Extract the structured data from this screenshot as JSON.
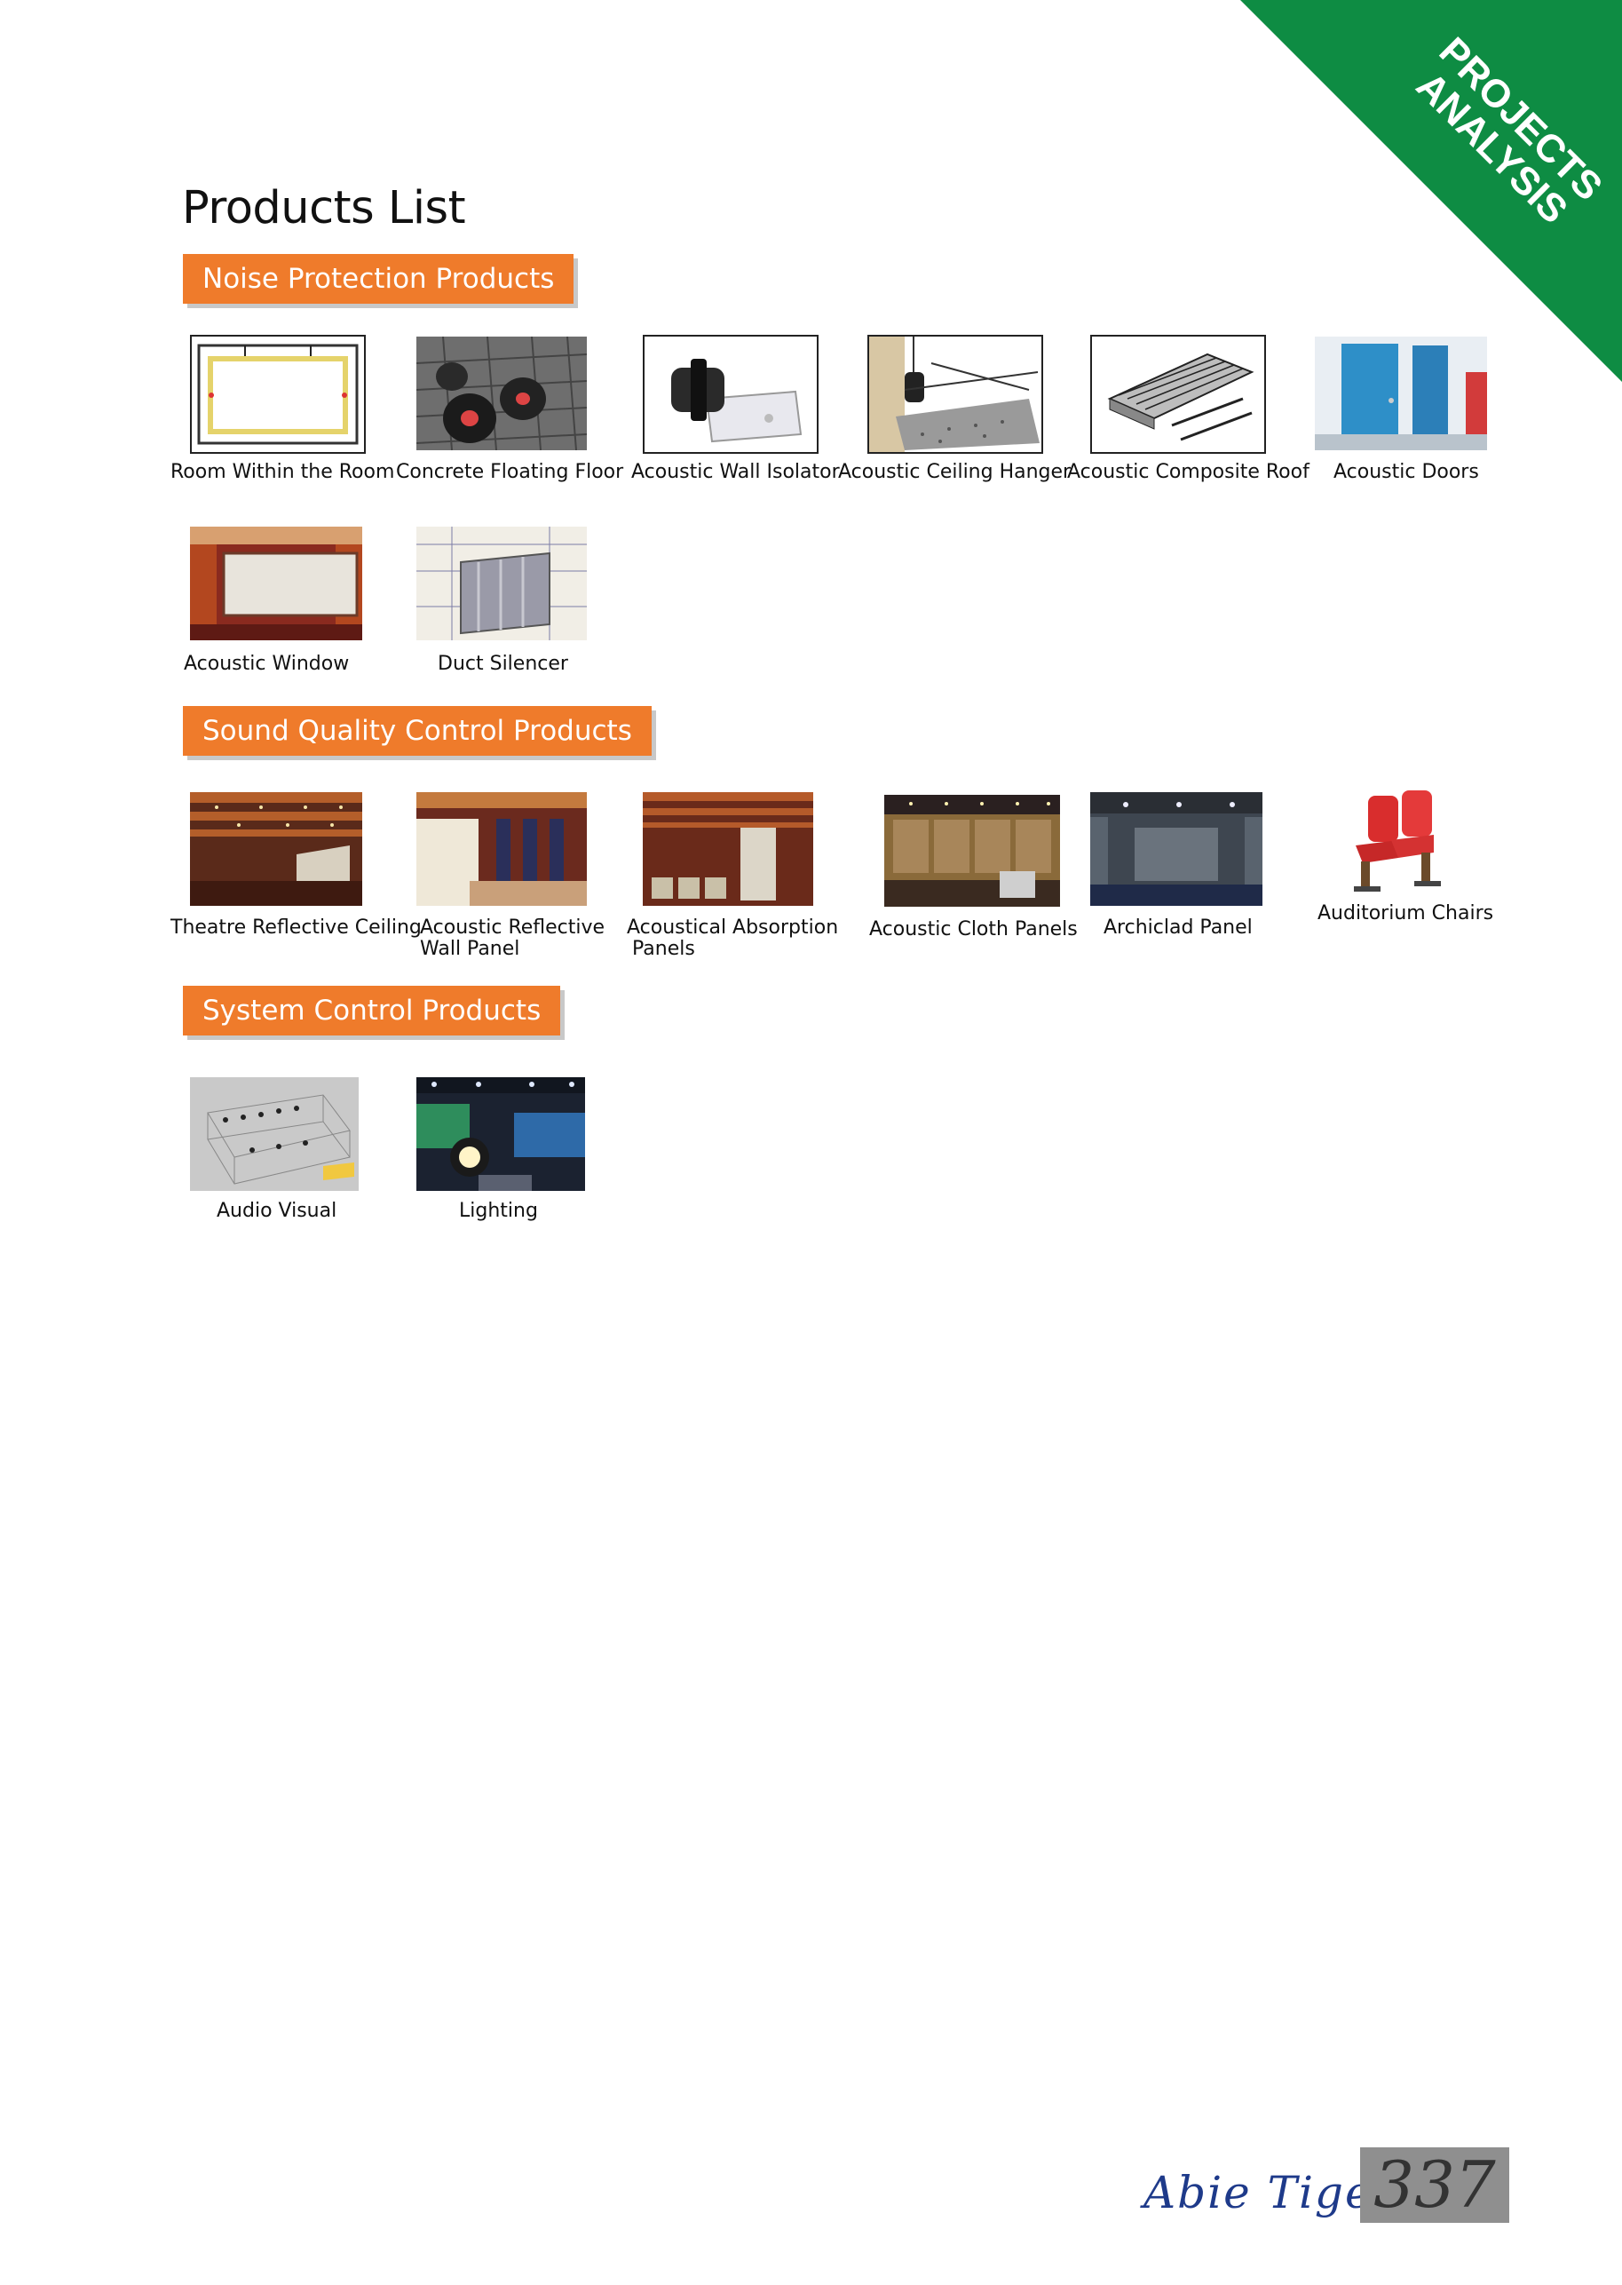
{
  "corner_banner": {
    "line1": "PROJECTS",
    "line2": "ANALYSIS",
    "color": "#0e8c43"
  },
  "page_title": "Products List",
  "sections": {
    "noise": {
      "label": "Noise Protection Products"
    },
    "sound": {
      "label": "Sound Quality Control Products"
    },
    "system": {
      "label": "System Control Products"
    }
  },
  "products": {
    "room_within_room": "Room Within the Room",
    "concrete_floating_floor": "Concrete Floating Floor",
    "acoustic_wall_isolator": "Acoustic Wall Isolator",
    "acoustic_ceiling_hanger": "Acoustic Ceiling Hanger",
    "acoustic_composite_roof": "Acoustic Composite Roof",
    "acoustic_doors": "Acoustic Doors",
    "acoustic_window": "Acoustic Window",
    "duct_silencer": "Duct Silencer",
    "theatre_reflective_ceiling": "Theatre Reflective Ceiling",
    "acoustic_reflective_wall_panel_1": "Acoustic Reflective",
    "acoustic_reflective_wall_panel_2": "Wall Panel",
    "acoustical_absorption_panels_1": "Acoustical Absorption",
    "acoustical_absorption_panels_2": "Panels",
    "acoustic_cloth_panels": "Acoustic Cloth Panels",
    "archiclad_panel": "Archiclad Panel",
    "auditorium_chairs": "Auditorium Chairs",
    "audio_visual": "Audio Visual",
    "lighting": "Lighting"
  },
  "footer": {
    "brand": "Abie Tiger",
    "page_number": "337"
  },
  "colors": {
    "accent": "#ef7b2b",
    "banner": "#0e8c43",
    "brand": "#1e3a8a"
  }
}
